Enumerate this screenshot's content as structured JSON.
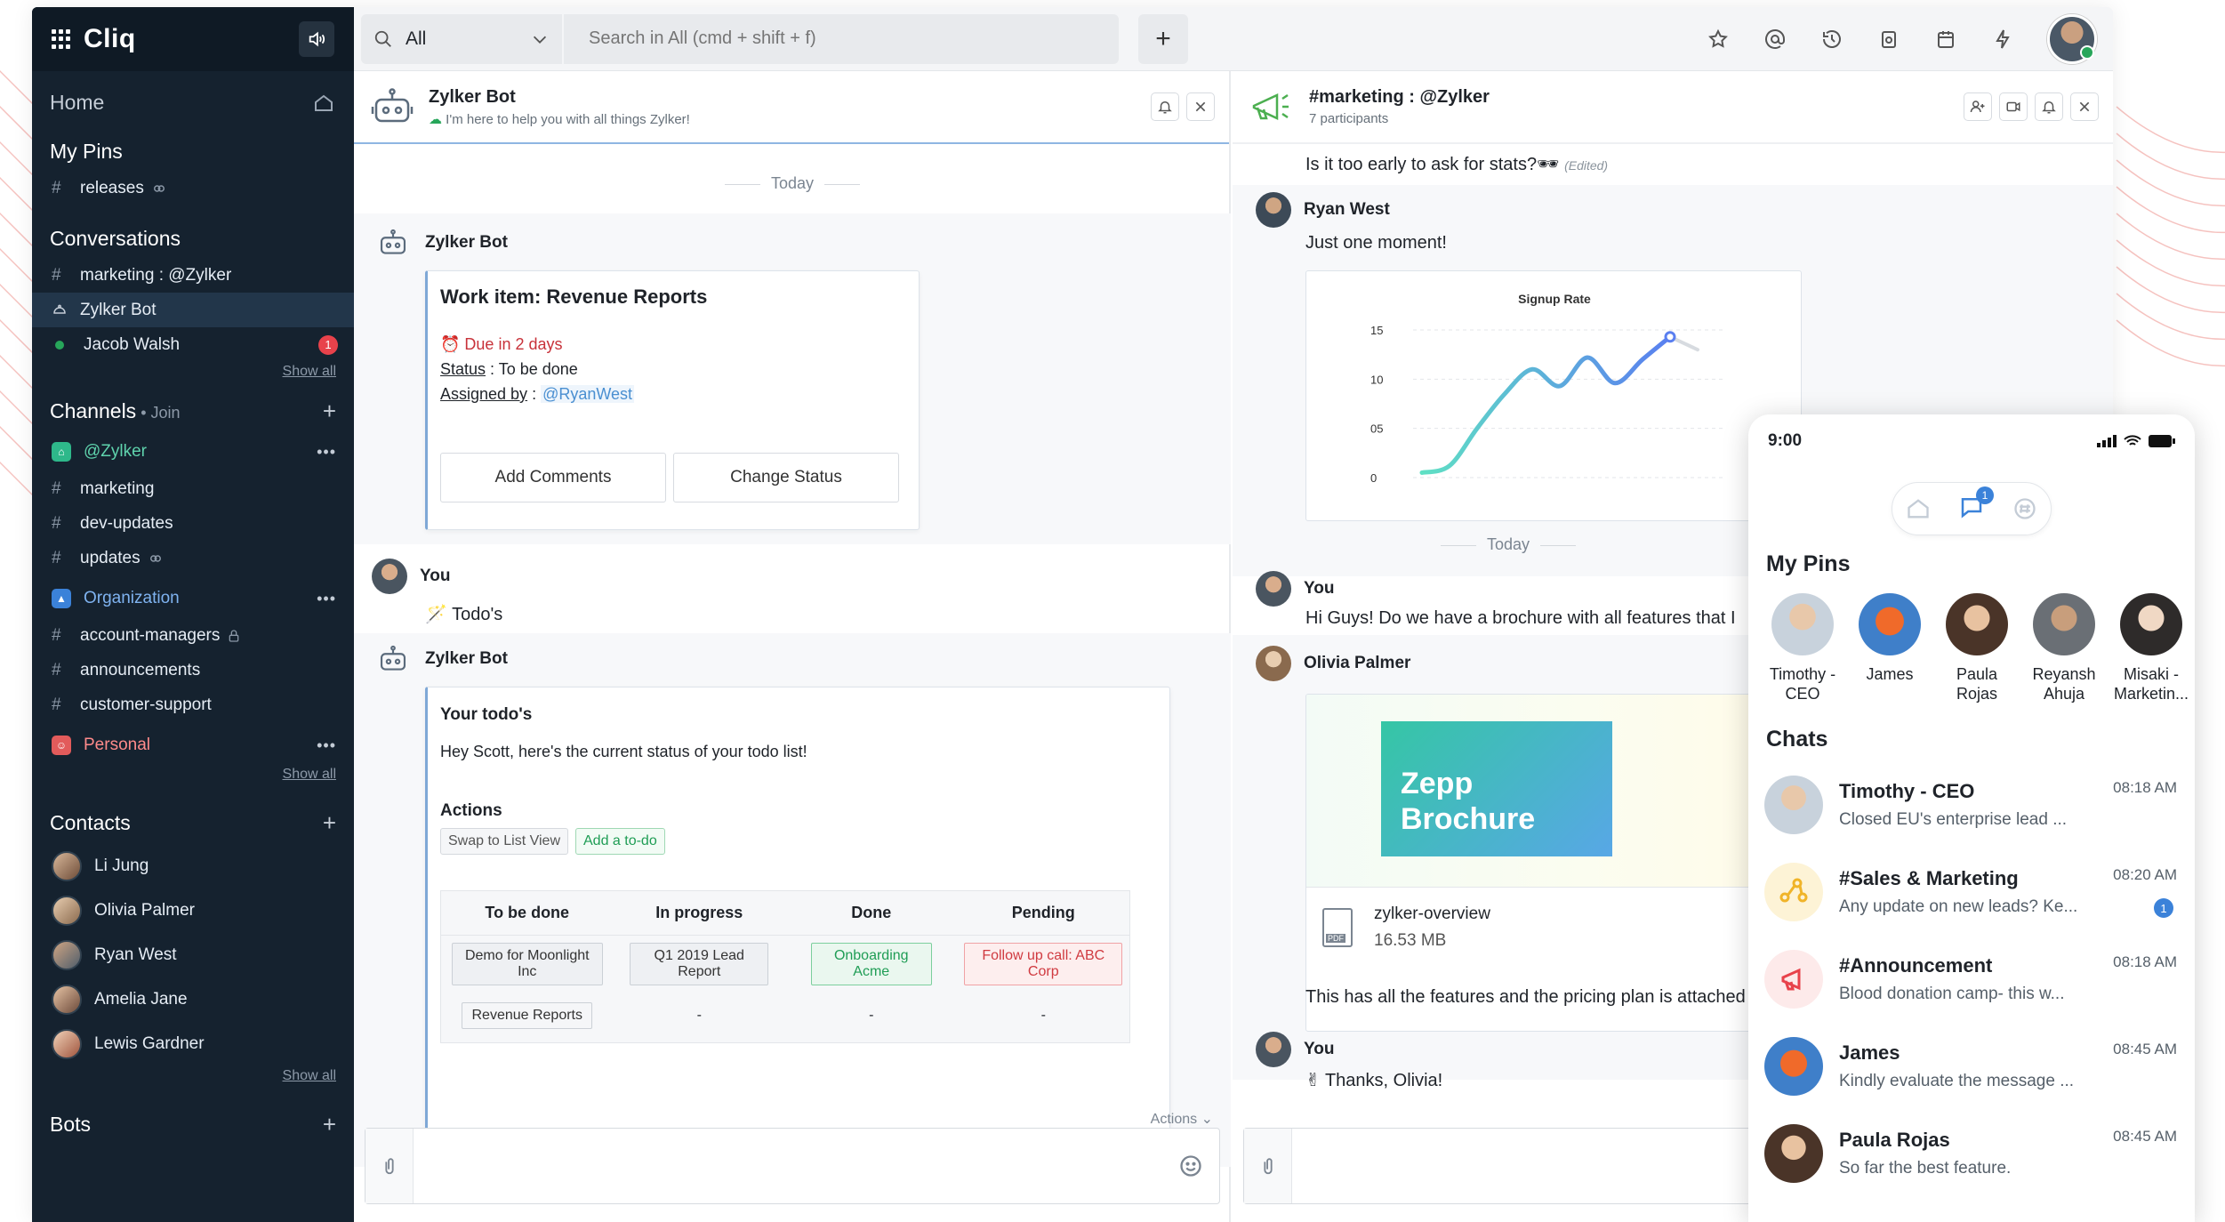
{
  "app": {
    "brand": "Cliq"
  },
  "colors": {
    "sidebar": "#15222f",
    "accent": "#4a8fd1",
    "unread": "#e8424b",
    "online": "#27a65a",
    "due": "#c8323a"
  },
  "sidebar": {
    "home": "Home",
    "my_pins": {
      "title": "My Pins",
      "items": [
        {
          "label": "releases"
        }
      ]
    },
    "conversations": {
      "title": "Conversations",
      "items": [
        {
          "label": "marketing : @Zylker"
        },
        {
          "label": "Zylker Bot"
        },
        {
          "label": "Jacob Walsh",
          "badge": "1"
        }
      ],
      "show_all": "Show all"
    },
    "channels": {
      "title": "Channels",
      "join": "Join",
      "orgs": [
        {
          "label": "@Zylker",
          "color": "#2eb88a",
          "items": [
            "marketing",
            "dev-updates",
            "updates"
          ]
        },
        {
          "label": "Organization",
          "color": "#3b82d9",
          "items": [
            "account-managers",
            "announcements",
            "customer-support"
          ]
        },
        {
          "label": "Personal",
          "color": "#e25b5b",
          "items": []
        }
      ],
      "show_all": "Show all"
    },
    "contacts": {
      "title": "Contacts",
      "items": [
        "Li Jung",
        "Olivia Palmer",
        "Ryan West",
        "Amelia Jane",
        "Lewis Gardner"
      ],
      "show_all": "Show all"
    },
    "bots": {
      "title": "Bots"
    }
  },
  "topbar": {
    "scope": "All",
    "search_placeholder": "Search in All (cmd + shift + f)",
    "icons": [
      "star-icon",
      "at-icon",
      "history-icon",
      "reminder-icon",
      "calendar-icon",
      "plug-icon"
    ]
  },
  "left_pane": {
    "header": {
      "title": "Zylker Bot",
      "subtitle": "I'm here to help you with all things Zylker!"
    },
    "day": "Today",
    "msg1": {
      "sender": "Zylker Bot",
      "card_title": "Work item: Revenue Reports",
      "due": "Due in  2 days",
      "status_label": "Status",
      "status_value": " : To be done",
      "assigned_label": "Assigned by",
      "assigned_sep": " : ",
      "assigned_value": "@RyanWest",
      "btn_comments": "Add Comments",
      "btn_status": "Change Status"
    },
    "msg2": {
      "sender": "You",
      "text": "Todo's"
    },
    "msg3": {
      "sender": "Zylker Bot",
      "title": "Your todo's",
      "text": "Hey Scott, here's the current status of your todo list!",
      "actions_label": "Actions",
      "btn_swap": "Swap to List View",
      "btn_add": "Add a to-do",
      "columns": [
        "To be done",
        "In progress",
        "Done",
        "Pending"
      ],
      "row1": [
        "Demo for Moonlight Inc",
        "Q1 2019 Lead Report",
        "Onboarding Acme",
        "Follow up call: ABC Corp"
      ],
      "row2": [
        "Revenue Reports",
        "-",
        "-",
        "-"
      ]
    },
    "actions": "Actions"
  },
  "right_pane": {
    "header": {
      "title": "#marketing : @Zylker",
      "subtitle": "7 participants"
    },
    "msg0": {
      "text": "Is it too early to ask for stats?",
      "edited": "(Edited)"
    },
    "msg1": {
      "sender": "Ryan West",
      "text": "Just one moment!"
    },
    "day": "Today",
    "msg2": {
      "sender": "You",
      "text": "Hi Guys! Do we have a brochure with all features that I"
    },
    "msg3": {
      "sender": "Olivia Palmer",
      "brochure_line1": "Zepp",
      "brochure_line2": "Brochure",
      "file_name": "zylker-overview",
      "file_size": "16.53 MB",
      "file_type": "PDF",
      "text": "This has all the features and the pricing plan is attached"
    },
    "msg4": {
      "sender": "You",
      "text": "Thanks, Olivia!"
    }
  },
  "chart_data": {
    "type": "line",
    "title": "Signup Rate",
    "yticks": [
      "15",
      "10",
      "05",
      "0"
    ],
    "ylim": [
      0,
      15
    ],
    "x": [
      0,
      1,
      2,
      3,
      4,
      5,
      6,
      7,
      8,
      9,
      10
    ],
    "values": [
      0.5,
      1.2,
      5.0,
      8.5,
      11.0,
      9.3,
      12.2,
      9.6,
      12.0,
      14.3,
      13.0
    ],
    "highlight_from": 9,
    "grid": true
  },
  "phone": {
    "time": "9:00",
    "tab_badge": "1",
    "my_pins_title": "My Pins",
    "pins": [
      {
        "line1": "Timothy -",
        "line2": "CEO"
      },
      {
        "line1": "James",
        "line2": ""
      },
      {
        "line1": "Paula",
        "line2": "Rojas"
      },
      {
        "line1": "Reyansh",
        "line2": "Ahuja"
      },
      {
        "line1": "Misaki -",
        "line2": "Marketin..."
      }
    ],
    "chats_title": "Chats",
    "chats": [
      {
        "name": "Timothy - CEO",
        "preview": "Closed EU's enterprise lead ...",
        "time": "08:18 AM"
      },
      {
        "name": "#Sales & Marketing",
        "preview": "Any update on new leads? Ke...",
        "time": "08:20 AM",
        "badge": "1"
      },
      {
        "name": "#Announcement",
        "preview": "Blood donation camp- this w...",
        "time": "08:18 AM"
      },
      {
        "name": "James",
        "preview": "Kindly evaluate the message ...",
        "time": "08:45 AM"
      },
      {
        "name": "Paula Rojas",
        "preview": "So far the best feature.",
        "time": "08:45 AM"
      }
    ]
  }
}
